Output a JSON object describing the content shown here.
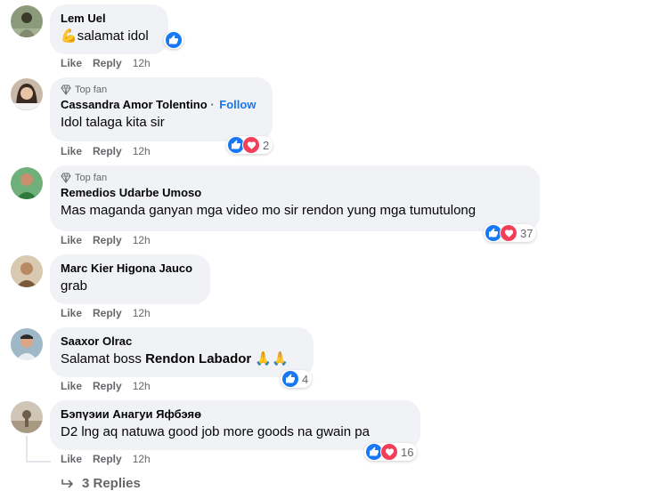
{
  "actions": {
    "like": "Like",
    "reply": "Reply"
  },
  "comments": [
    {
      "name": "Lem Uel",
      "text": "salamat idol",
      "prefix_emoji": "💪",
      "time": "12h",
      "reaction_icons": [
        "like"
      ]
    },
    {
      "top_fan": "Top fan",
      "name": "Cassandra Amor Tolentino",
      "follow": "Follow",
      "text": "Idol talaga kita sir",
      "time": "12h",
      "reaction_icons": [
        "like",
        "love"
      ],
      "reaction_count": "2"
    },
    {
      "top_fan": "Top fan",
      "name": "Remedios Udarbe Umoso",
      "text": "Mas maganda ganyan mga video mo sir rendon yung mga tumutulong",
      "time": "12h",
      "reaction_icons": [
        "like",
        "love"
      ],
      "reaction_count": "37"
    },
    {
      "name": "Marc Kier Higona Jauco",
      "text": "grab",
      "time": "12h"
    },
    {
      "name": "Saaxor Olrac",
      "text": "Salamat boss",
      "mention": "Rendon Labador",
      "suffix_emoji": "🙏🙏",
      "time": "12h",
      "reaction_icons": [
        "like"
      ],
      "reaction_count": "4"
    },
    {
      "name": "Бэпүэии Анагуи Яфбэяө",
      "text": "D2 lng aq natuwa good job more goods na gwain pa",
      "time": "12h",
      "reaction_icons": [
        "like",
        "love"
      ],
      "reaction_count": "16"
    }
  ],
  "replies_link": "3 Replies",
  "colors": {
    "bubble": "#f0f2f5",
    "link_blue": "#1877f2",
    "like_blue": "#1877f2",
    "love_red": "#f33e58",
    "secondary_text": "#65676b"
  }
}
